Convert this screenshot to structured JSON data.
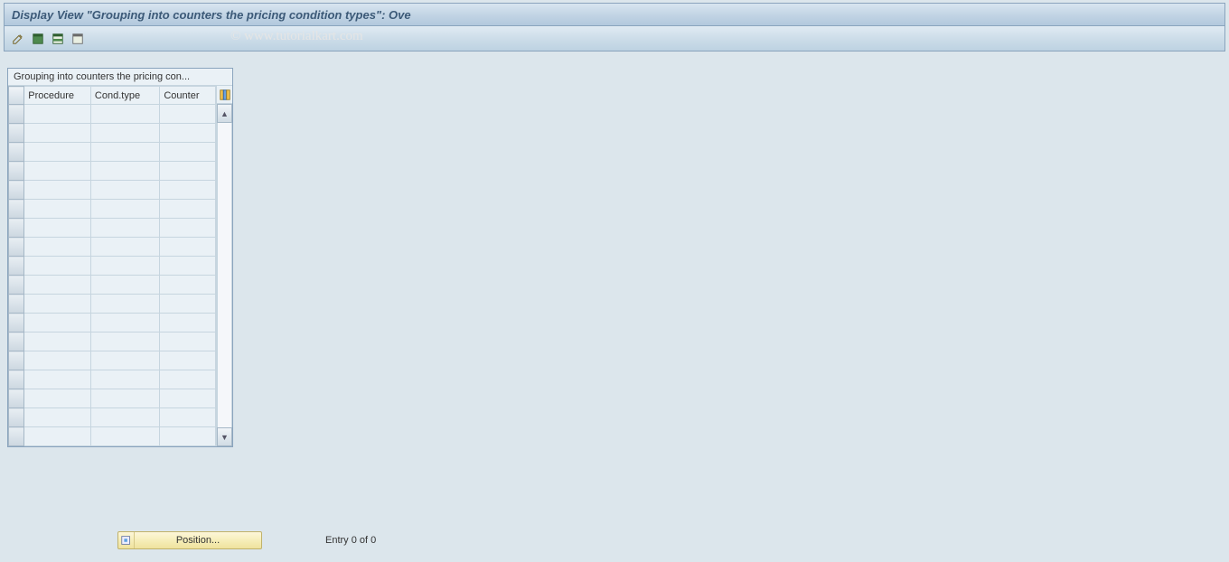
{
  "title": "Display View \"Grouping into counters the pricing condition types\": Ove",
  "watermark": "© www.tutorialkart.com",
  "toolbar": {
    "icons": {
      "change": "change-display-icon",
      "select_all": "select-all-icon",
      "select_block": "select-block-icon",
      "deselect_all": "deselect-all-icon"
    }
  },
  "table": {
    "caption": "Grouping into counters the pricing con...",
    "columns": {
      "procedure": "Procedure",
      "cond_type": "Cond.type",
      "counter": "Counter"
    },
    "rows_visible": 18
  },
  "footer": {
    "position_label": "Position...",
    "entry_text": "Entry 0 of 0"
  },
  "colors": {
    "header_bg": "#c3d5e5",
    "border": "#8aa4bd",
    "body_bg": "#dce6ec"
  }
}
